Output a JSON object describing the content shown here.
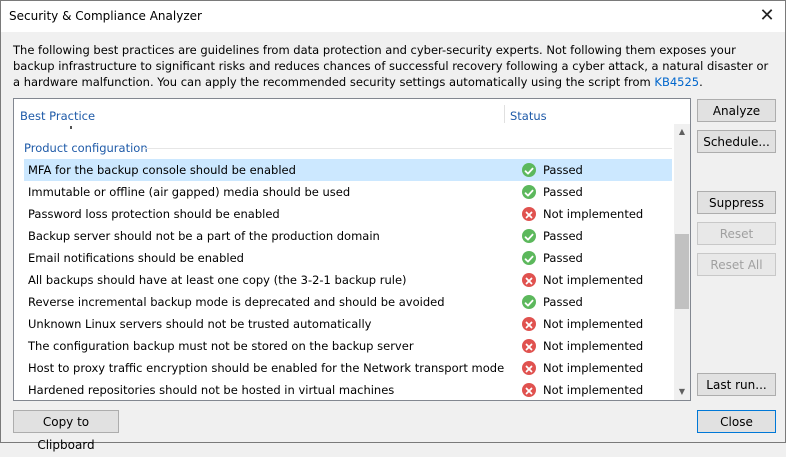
{
  "window": {
    "title": "Security & Compliance Analyzer",
    "close_glyph": "✕"
  },
  "intro": {
    "text": "The following best practices are guidelines from data protection and cyber-security experts. Not following them exposes your backup infrastructure to significant risks and reduces chances of successful recovery following a cyber attack, a natural disaster or a hardware malfunction. You can apply the recommended security settings automatically using the script from ",
    "link": "KB4525",
    "suffix": "."
  },
  "table": {
    "columns": {
      "practice": "Best Practice",
      "status": "Status"
    },
    "group": "Product configuration",
    "rows": [
      {
        "practice": "MFA for the backup console should be enabled",
        "status": "Passed",
        "ok": true,
        "selected": true
      },
      {
        "practice": "Immutable or offline (air gapped) media should be used",
        "status": "Passed",
        "ok": true
      },
      {
        "practice": "Password loss protection should be enabled",
        "status": "Not implemented",
        "ok": false
      },
      {
        "practice": "Backup server should not be a part of the production domain",
        "status": "Passed",
        "ok": true
      },
      {
        "practice": "Email notifications should be enabled",
        "status": "Passed",
        "ok": true
      },
      {
        "practice": "All backups should have at least one copy (the 3-2-1 backup rule)",
        "status": "Not implemented",
        "ok": false
      },
      {
        "practice": "Reverse incremental backup mode is deprecated and should be avoided",
        "status": "Passed",
        "ok": true
      },
      {
        "practice": "Unknown Linux servers should not be trusted automatically",
        "status": "Not implemented",
        "ok": false
      },
      {
        "practice": "The configuration backup must not be stored on the backup server",
        "status": "Not implemented",
        "ok": false
      },
      {
        "practice": "Host to proxy traffic encryption should be enabled for the Network transport mode",
        "status": "Not implemented",
        "ok": false
      },
      {
        "practice": "Hardened repositories should not be hosted in virtual machines",
        "status": "Not implemented",
        "ok": false
      }
    ]
  },
  "buttons": {
    "analyze": "Analyze",
    "schedule": "Schedule...",
    "suppress": "Suppress",
    "reset": "Reset",
    "reset_all": "Reset All",
    "last_run": "Last run...",
    "copy": "Copy to Clipboard",
    "close": "Close"
  },
  "colors": {
    "passed": "#5cb85c",
    "not_implemented": "#e0524f",
    "selection": "#cce8ff",
    "accent": "#1e5aa8"
  }
}
